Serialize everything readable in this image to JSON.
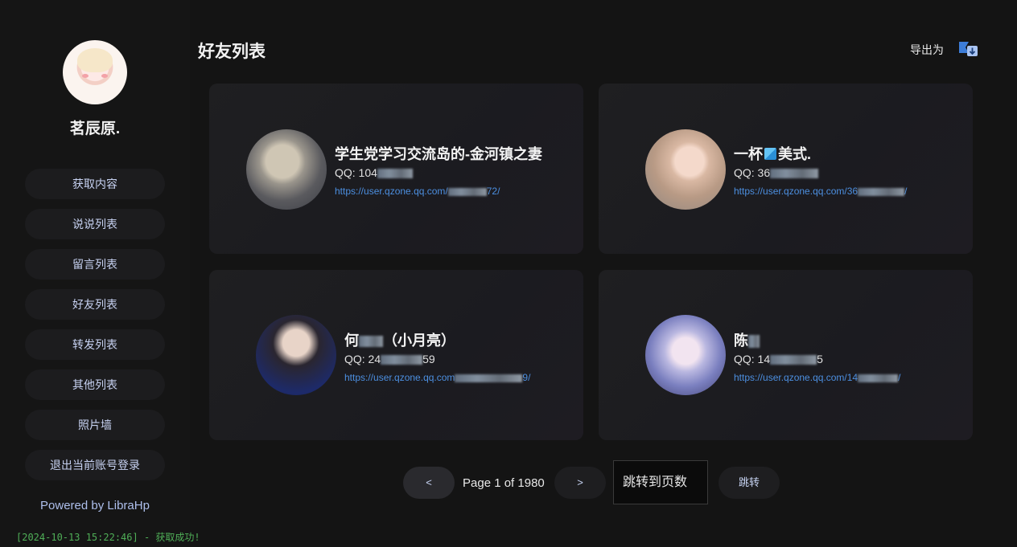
{
  "sidebar": {
    "username": "茗辰原.",
    "nav": [
      "获取内容",
      "说说列表",
      "留言列表",
      "好友列表",
      "转发列表",
      "其他列表",
      "照片墙",
      "退出当前账号登录"
    ],
    "powered": "Powered by LibraHp",
    "log": "[2024-10-13 15:22:46] - 获取成功!"
  },
  "header": {
    "title": "好友列表",
    "export_label": "导出为"
  },
  "friends": [
    {
      "name": "学生党学习交流岛的-金河镇之妻",
      "qq_prefix": "QQ: 104",
      "qq_suffix": "",
      "link_prefix": "https://user.qzone.qq.com/",
      "link_suffix": "72/"
    },
    {
      "name_prefix": "一杯",
      "name_suffix": "美式.",
      "qq_prefix": "QQ: 36",
      "qq_suffix": "",
      "link_prefix": "https://user.qzone.qq.com/36",
      "link_suffix": "/"
    },
    {
      "name_prefix": "何",
      "name_suffix": "（小月亮）",
      "qq_prefix": "QQ: 24",
      "qq_suffix": "59",
      "link_prefix": "https://user.qzone.qq.com",
      "link_suffix": "9/"
    },
    {
      "name": "陈",
      "qq_prefix": "QQ: 14",
      "qq_suffix": "5",
      "link_prefix": "https://user.qzone.qq.com/14",
      "link_suffix": "/"
    }
  ],
  "pagination": {
    "prev": "<",
    "next": ">",
    "page_text": "Page 1 of 1980",
    "jump_placeholder": "跳转到页数",
    "jump_button": "跳转"
  },
  "colors": {
    "background": "#141414",
    "card": "#1f1f21",
    "link": "#4c8fe0",
    "nav_text": "#c7d2f2",
    "log": "#4fae57"
  }
}
